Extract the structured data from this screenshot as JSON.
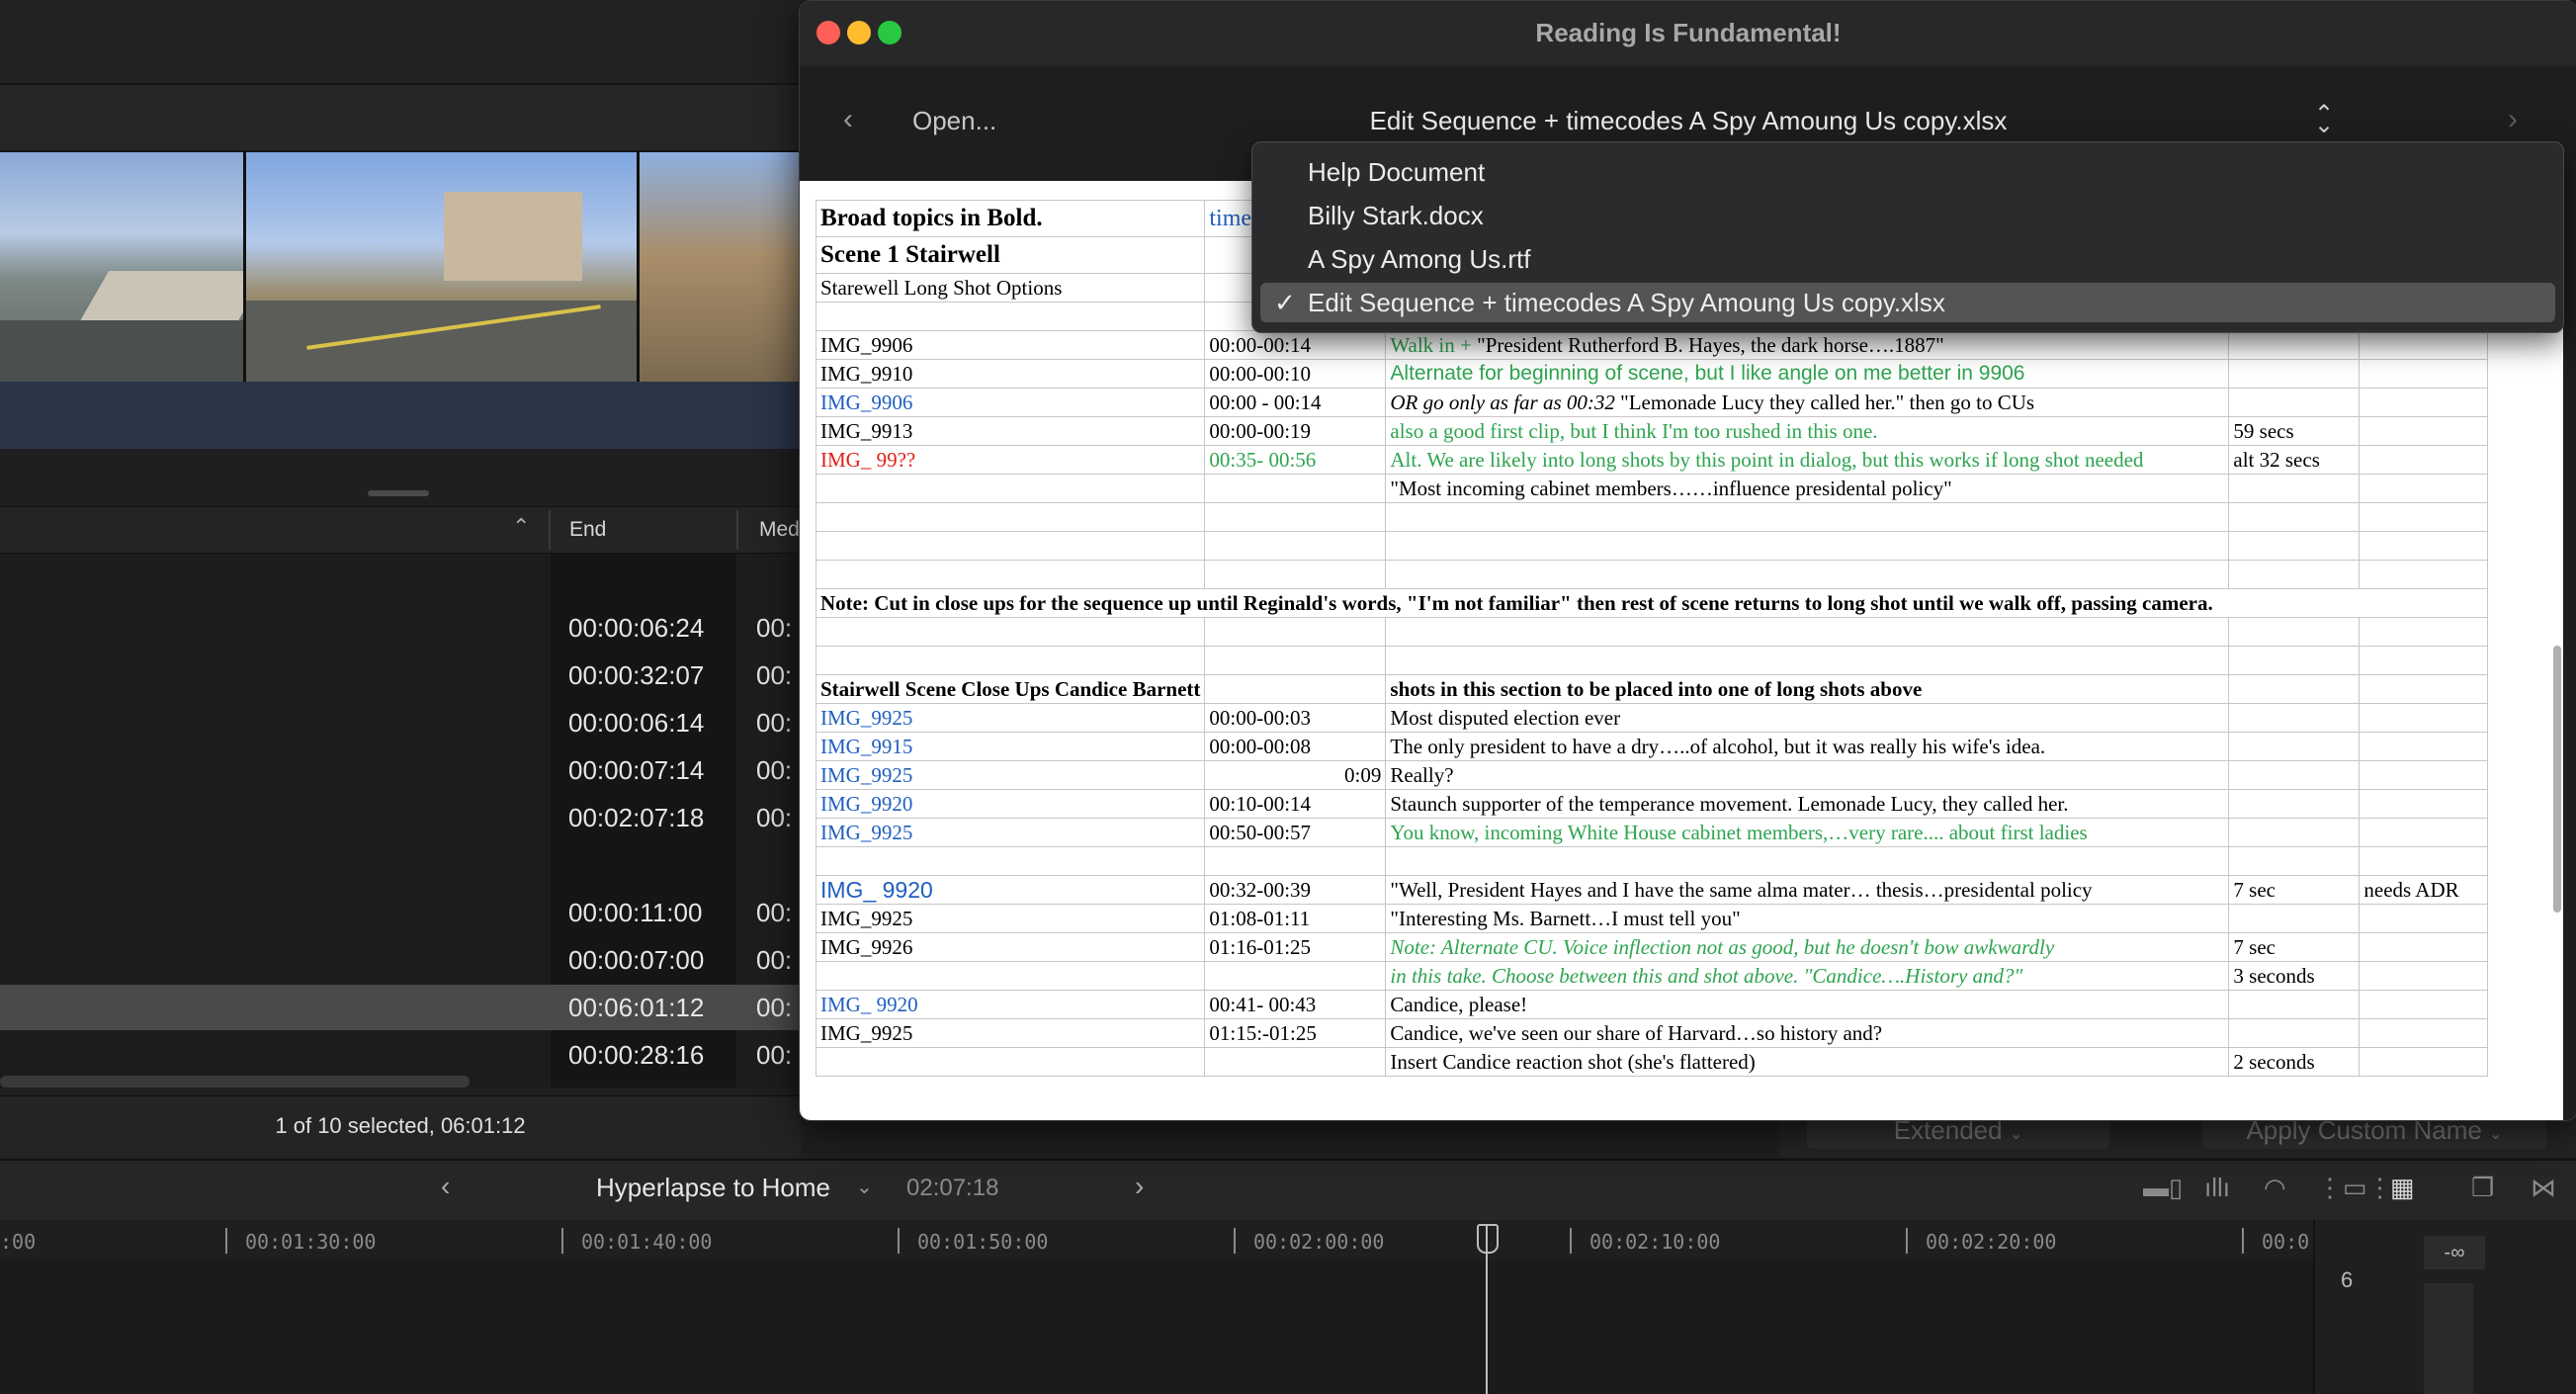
{
  "editor": {
    "browser": {
      "col_end": "End",
      "col_media": "Med",
      "end_values": [
        "00:00:06:24",
        "00:00:32:07",
        "00:00:06:14",
        "00:00:07:14",
        "00:02:07:18",
        "",
        "00:00:11:00",
        "00:00:07:00",
        "00:06:01:12",
        "00:00:28:16"
      ],
      "media_values": [
        "00:",
        "00:",
        "00:",
        "00:",
        "00:",
        "",
        "00:",
        "00:",
        "00:",
        "00:"
      ],
      "status": "1 of 10 selected, 06:01:12",
      "extended_label": "Extended",
      "apply_custom_label": "Apply Custom Name"
    },
    "timeline": {
      "title": "Hyperlapse to Home",
      "duration": "02:07:18",
      "ticks": [
        ":00",
        "00:01:30:00",
        "00:01:40:00",
        "00:01:50:00",
        "00:02:00:00",
        "00:02:10:00",
        "00:02:20:00",
        "00:0"
      ],
      "meter_value": "-∞",
      "meter_scale": "6"
    }
  },
  "rif": {
    "title": "Reading Is Fundamental!",
    "open_label": "Open...",
    "current_file": "Edit Sequence + timecodes A Spy Amoung Us copy.xlsx",
    "menu": {
      "items": [
        {
          "label": "Help Document",
          "checked": false
        },
        {
          "label": "Billy Stark.docx",
          "checked": false
        },
        {
          "label": "A Spy Among Us.rtf",
          "checked": false
        },
        {
          "label": "Edit Sequence + timecodes A Spy Amoung Us copy.xlsx",
          "checked": true
        }
      ],
      "check": "✓"
    },
    "sheet": {
      "r1": {
        "a": "Broad topics in Bold.",
        "b": "time code"
      },
      "r2": {
        "a": "Scene 1 Stairwell"
      },
      "r3": {
        "a": "Starewell Long Shot Options"
      },
      "r5": {
        "a": "IMG_9906",
        "b": "00:00-00:14",
        "c1": "Walk in + ",
        "c2": "\"President Rutherford B. Hayes, the dark horse….1887\""
      },
      "r6": {
        "a": "IMG_9910",
        "b": "00:00-00:10",
        "c": "Alternate for beginning of scene, but I like angle on me better in 9906"
      },
      "r7": {
        "a": "IMG_9906",
        "b": "00:00 - 00:14",
        "c1": "OR go only as far as 00:32",
        "c2": " \"Lemonade Lucy they called her.\"  then go to CUs"
      },
      "r8": {
        "a": "IMG_9913",
        "b": "00:00-00:19",
        "c": "also a good first clip, but I think I'm too rushed in this one.",
        "d": "59 secs"
      },
      "r9": {
        "a": "IMG_ 99??",
        "b": "00:35- 00:56",
        "c": "Alt. We are likely into long shots by this point in dialog, but this works if long shot needed",
        "d": "alt 32 secs"
      },
      "r10": {
        "c": " \"Most incoming cabinet members……influence presidental policy\""
      },
      "note": "Note: Cut in close ups for the sequence up until Reginald's words, \"I'm not familiar\"  then rest of scene returns to long shot until we walk off, passing camera.",
      "cu_header": {
        "a": "Stairwell Scene Close Ups Candice Barnett",
        "c": "shots in this section to be placed into one of long shots above"
      },
      "cu_rows": [
        {
          "a": "IMG_9925",
          "b": "00:00-00:03",
          "c": "Most disputed election ever"
        },
        {
          "a": "IMG_9915",
          "b": "00:00-00:08",
          "c": "The only president to have a dry…..of alcohol, but it was really his wife's idea."
        },
        {
          "a": "IMG_9925",
          "b": "0:09",
          "c": "Really?"
        },
        {
          "a": "IMG_9920",
          "b": "00:10-00:14",
          "c": "Staunch supporter of the temperance movement. Lemonade Lucy, they called her."
        },
        {
          "a": "IMG_9925",
          "b": "00:50-00:57",
          "c": "You know, incoming White House cabinet members,…very rare.... about first ladies"
        }
      ],
      "r_9920": {
        "a": "IMG_ 9920",
        "b": "00:32-00:39",
        "c": "\"Well, President Hayes and I have the same alma mater… thesis…presidental policy",
        "d": "7 sec",
        "e": "needs ADR"
      },
      "r_9925b": {
        "a": "IMG_9925",
        "b": "01:08-01:11",
        "c": "\"Interesting Ms. Barnett…I must tell you\""
      },
      "r_9926": {
        "a": "IMG_9926",
        "b": "01:16-01:25",
        "c": "Note: Alternate CU. Voice inflection not as good, but he doesn't bow awkwardly",
        "d": "7 sec"
      },
      "r_9926b": {
        "c": "in this take.  Choose between this and shot above. \"Candice….History and?\"",
        "d": "3 seconds"
      },
      "r_9920b": {
        "a": "IMG_ 9920",
        "b": "00:41- 00:43",
        "c": "Candice, please!"
      },
      "r_9925c": {
        "a": "IMG_9925",
        "b": "01:15:-01:25",
        "c": "Candice, we've seen our share of Harvard…so history and?"
      },
      "r_last": {
        "c": "Insert Candice reaction shot (she's flattered)",
        "d": "2 seconds"
      }
    }
  }
}
